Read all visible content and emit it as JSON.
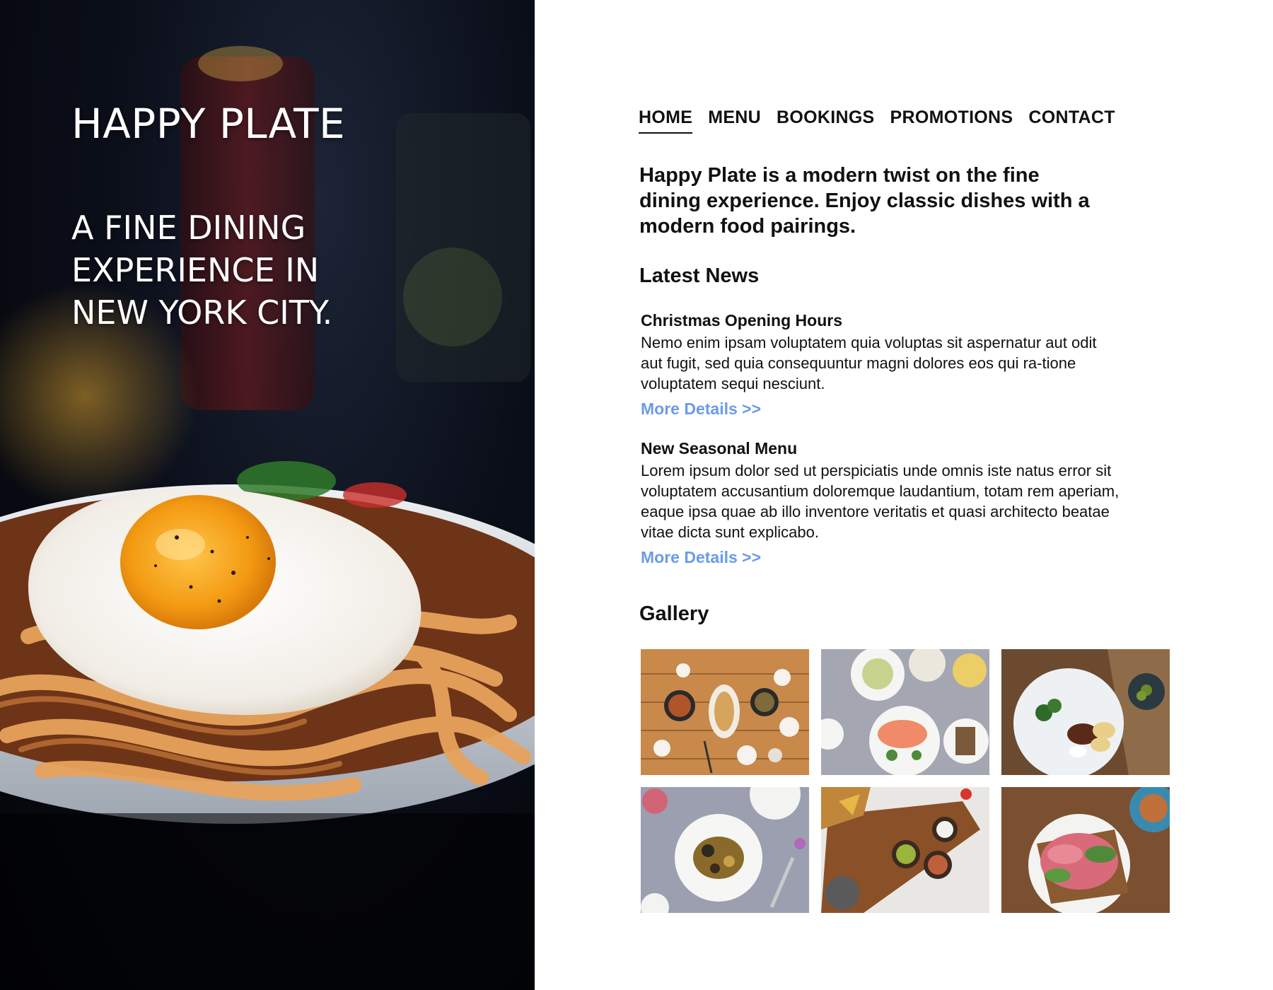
{
  "hero": {
    "title": "HAPPY PLATE",
    "tagline": "A FINE DINING EXPERIENCE IN NEW YORK CITY.",
    "image": "fried-egg-noodle-bowl"
  },
  "nav": {
    "items": [
      {
        "label": "HOME",
        "active": true
      },
      {
        "label": "MENU",
        "active": false
      },
      {
        "label": "BOOKINGS",
        "active": false
      },
      {
        "label": "PROMOTIONS",
        "active": false
      },
      {
        "label": "CONTACT",
        "active": false
      }
    ]
  },
  "intro": "Happy Plate is a modern twist on the fine dining experience. Enjoy classic dishes with a modern food pairings.",
  "news": {
    "heading": "Latest News",
    "items": [
      {
        "title": "Christmas Opening Hours",
        "body": "Nemo enim ipsam voluptatem quia voluptas sit aspernatur aut odit aut fugit, sed quia consequuntur magni dolores eos qui ra-tione voluptatem sequi nesciunt.",
        "link": "More Details >>"
      },
      {
        "title": "New Seasonal Menu",
        "body": "Lorem ipsum dolor sed ut perspiciatis unde omnis iste natus error sit voluptatem accusantium doloremque laudantium, totam rem aperiam, eaque ipsa quae ab illo inventore veritatis et quasi architecto beatae vitae dicta sunt explicabo.",
        "link": "More Details >>"
      }
    ]
  },
  "gallery": {
    "heading": "Gallery",
    "images": [
      "korean-banchan-table",
      "salmon-salad-plates",
      "tortellini-plate",
      "roasted-vegetable-plate",
      "nachos-guacamole-board",
      "roast-beef-sandwich"
    ]
  },
  "colors": {
    "link": "#6b9be8",
    "text": "#111111",
    "hero_bg": "#0b0f1a"
  }
}
